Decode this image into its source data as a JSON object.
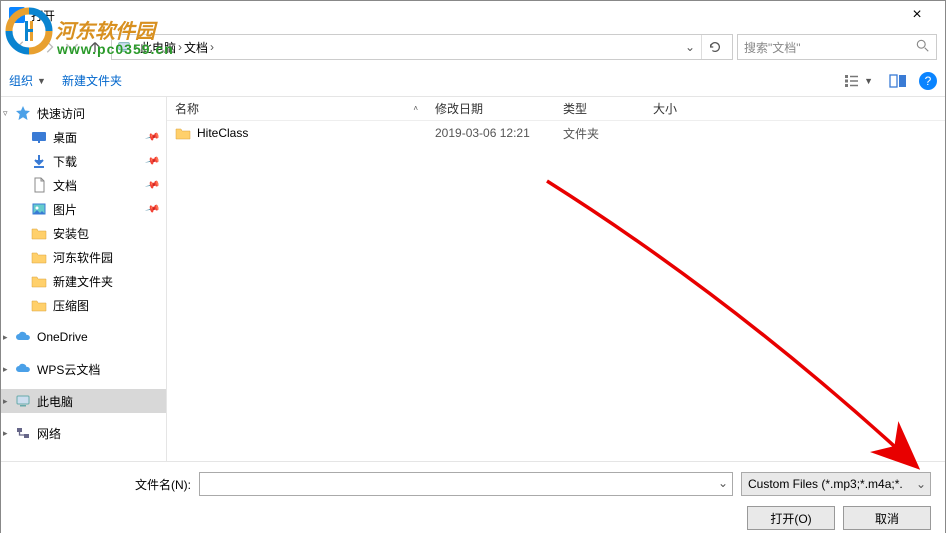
{
  "title": "打开",
  "watermark": {
    "text": "河东软件园",
    "url": "www.pc0359.cn"
  },
  "nav": {
    "path_segs": [
      "此电脑",
      "文档"
    ],
    "search_placeholder": "搜索\"文档\""
  },
  "toolbar": {
    "organize": "组织",
    "new_folder": "新建文件夹"
  },
  "sidebar": {
    "quick": "快速访问",
    "desktop": "桌面",
    "downloads": "下载",
    "documents": "文档",
    "pictures": "图片",
    "pkg": "安装包",
    "hedong": "河东软件园",
    "newfolder": "新建文件夹",
    "compressed": "压缩图",
    "onedrive": "OneDrive",
    "wps": "WPS云文档",
    "thispc": "此电脑",
    "network": "网络"
  },
  "columns": {
    "name": "名称",
    "date": "修改日期",
    "type": "类型",
    "size": "大小"
  },
  "files": [
    {
      "name": "HiteClass",
      "date": "2019-03-06 12:21",
      "type": "文件夹"
    }
  ],
  "footer": {
    "filename_label": "文件名(N):",
    "filter": "Custom Files (*.mp3;*.m4a;*.",
    "open": "打开(O)",
    "cancel": "取消"
  }
}
